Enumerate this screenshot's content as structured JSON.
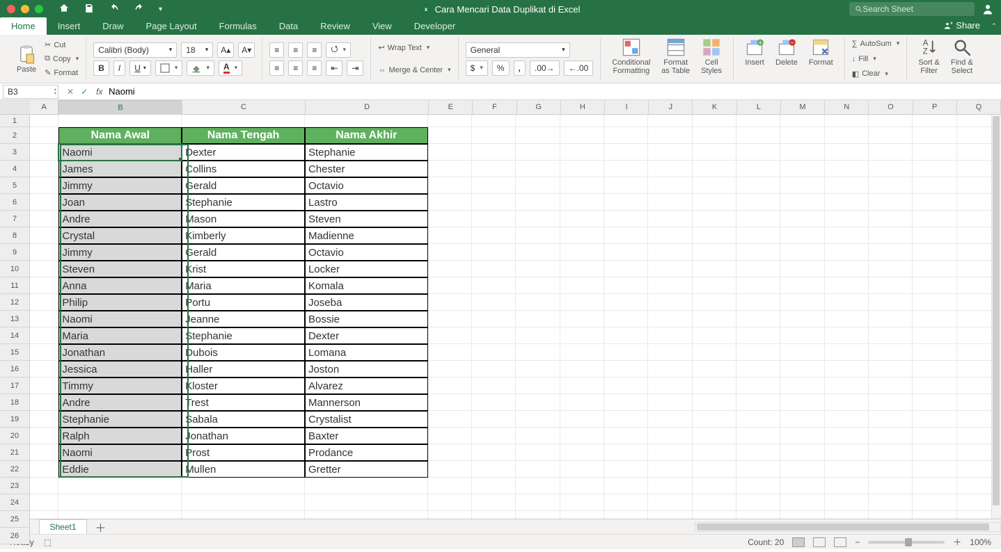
{
  "window": {
    "title": "Cara Mencari Data Duplikat di Excel",
    "search_placeholder": "Search Sheet"
  },
  "tabs": [
    "Home",
    "Insert",
    "Draw",
    "Page Layout",
    "Formulas",
    "Data",
    "Review",
    "View",
    "Developer"
  ],
  "active_tab": "Home",
  "share_label": "Share",
  "ribbon": {
    "paste": "Paste",
    "cut": "Cut",
    "copy": "Copy",
    "format_painter": "Format",
    "font_name": "Calibri (Body)",
    "font_size": "18",
    "wrap": "Wrap Text",
    "merge": "Merge & Center",
    "number_format": "General",
    "cond_fmt": "Conditional\nFormatting",
    "fmt_table": "Format\nas Table",
    "cell_styles": "Cell\nStyles",
    "insert": "Insert",
    "delete": "Delete",
    "format": "Format",
    "autosum": "AutoSum",
    "fill": "Fill",
    "clear": "Clear",
    "sort": "Sort &\nFilter",
    "find": "Find &\nSelect"
  },
  "formula_bar": {
    "cell_ref": "B3",
    "fx": "fx",
    "value": "Naomi"
  },
  "columns": [
    "A",
    "B",
    "C",
    "D",
    "E",
    "F",
    "G",
    "H",
    "I",
    "J",
    "K",
    "L",
    "M",
    "N",
    "O",
    "P",
    "Q"
  ],
  "selected_column": "B",
  "row_count_visible": 26,
  "table": {
    "header_row": 2,
    "headers": [
      "Nama Awal",
      "Nama Tengah",
      "Nama Akhir"
    ],
    "rows": [
      [
        "Naomi",
        "Dexter",
        "Stephanie"
      ],
      [
        "James",
        "Collins",
        "Chester"
      ],
      [
        "Jimmy",
        "Gerald",
        "Octavio"
      ],
      [
        "Joan",
        "Stephanie",
        "Lastro"
      ],
      [
        "Andre",
        "Mason",
        "Steven"
      ],
      [
        "Crystal",
        "Kimberly",
        "Madienne"
      ],
      [
        "Jimmy",
        "Gerald",
        "Octavio"
      ],
      [
        "Steven",
        "Krist",
        "Locker"
      ],
      [
        "Anna",
        "Maria",
        "Komala"
      ],
      [
        "Philip",
        "Portu",
        "Joseba"
      ],
      [
        "Naomi",
        "Jeanne",
        "Bossie"
      ],
      [
        "Maria",
        "Stephanie",
        "Dexter"
      ],
      [
        "Jonathan",
        "Dubois",
        "Lomana"
      ],
      [
        "Jessica",
        "Haller",
        "Joston"
      ],
      [
        "Timmy",
        "Kloster",
        "Alvarez"
      ],
      [
        "Andre",
        "Trest",
        "Mannerson"
      ],
      [
        "Stephanie",
        "Sabala",
        "Crystalist"
      ],
      [
        "Ralph",
        "Jonathan",
        "Baxter"
      ],
      [
        "Naomi",
        "Prost",
        "Prodance"
      ],
      [
        "Eddie",
        "Mullen",
        "Gretter"
      ]
    ]
  },
  "sheet_tabs": [
    "Sheet1"
  ],
  "status": {
    "ready": "Ready",
    "count": "Count: 20",
    "zoom": "100%"
  },
  "colors": {
    "brand": "#267245",
    "header_fill": "#5fb05f",
    "sel_fill": "#d9d9d9"
  }
}
